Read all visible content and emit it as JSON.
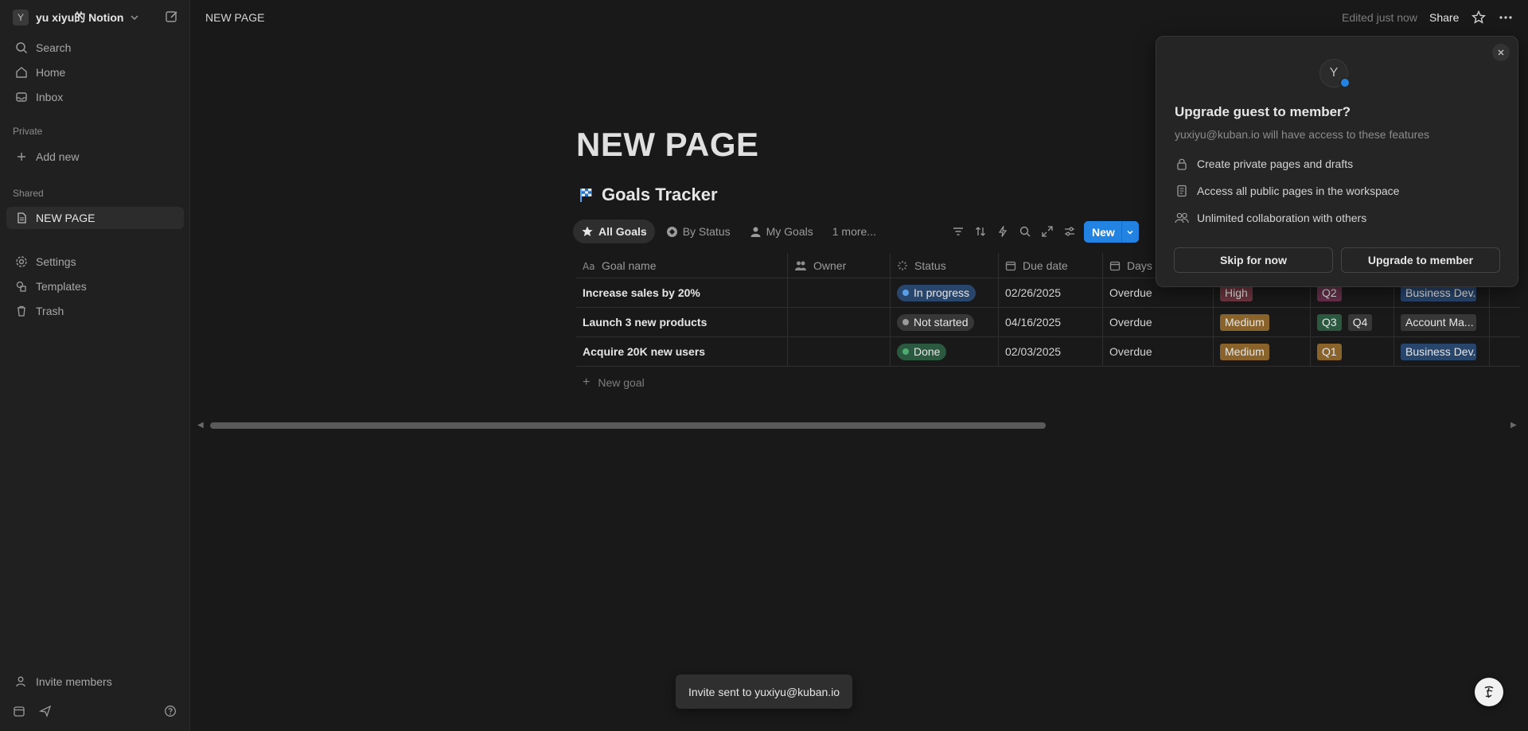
{
  "sidebar": {
    "workspace": {
      "avatar": "Y",
      "name": "yu xiyu的 Notion"
    },
    "nav": [
      {
        "label": "Search",
        "icon": "search-icon"
      },
      {
        "label": "Home",
        "icon": "home-icon"
      },
      {
        "label": "Inbox",
        "icon": "inbox-icon"
      }
    ],
    "private_section": "Private",
    "add_new": "Add new",
    "shared_section": "Shared",
    "shared_pages": [
      {
        "label": "NEW PAGE",
        "icon": "page-icon"
      }
    ],
    "bottom_nav": [
      {
        "label": "Settings",
        "icon": "settings-icon"
      },
      {
        "label": "Templates",
        "icon": "templates-icon"
      },
      {
        "label": "Trash",
        "icon": "trash-icon"
      }
    ],
    "invite": "Invite members"
  },
  "topbar": {
    "breadcrumb": "NEW PAGE",
    "edited": "Edited just now",
    "share": "Share"
  },
  "page": {
    "title": "NEW PAGE",
    "database": {
      "title": "Goals Tracker",
      "views": [
        {
          "label": "All Goals",
          "icon": "star-icon"
        },
        {
          "label": "By Status",
          "icon": "status-icon"
        },
        {
          "label": "My Goals",
          "icon": "person-icon"
        },
        {
          "label": "1 more..."
        }
      ],
      "new_button": "New",
      "columns": [
        "Goal name",
        "Owner",
        "Status",
        "Due date",
        "Days"
      ],
      "rows": [
        {
          "name": "Increase sales by 20%",
          "owner": "",
          "status": "In progress",
          "due": "02/26/2025",
          "days": "Overdue",
          "priority": "High",
          "quarters": [
            "Q2"
          ],
          "team": "Business Dev..."
        },
        {
          "name": "Launch 3 new products",
          "owner": "",
          "status": "Not started",
          "due": "04/16/2025",
          "days": "Overdue",
          "priority": "Medium",
          "quarters": [
            "Q3",
            "Q4"
          ],
          "team": "Account Ma..."
        },
        {
          "name": "Acquire 20K new users",
          "owner": "",
          "status": "Done",
          "due": "02/03/2025",
          "days": "Overdue",
          "priority": "Medium",
          "quarters": [
            "Q1"
          ],
          "team": "Business Dev..."
        }
      ],
      "new_row": "New goal"
    }
  },
  "popover": {
    "avatar": "Y",
    "title": "Upgrade guest to member?",
    "subtitle": "yuxiyu@kuban.io will have access to these features",
    "features": [
      {
        "label": "Create private pages and drafts",
        "icon": "lock-icon"
      },
      {
        "label": "Access all public pages in the workspace",
        "icon": "document-icon"
      },
      {
        "label": "Unlimited collaboration with others",
        "icon": "people-icon"
      }
    ],
    "skip": "Skip for now",
    "upgrade": "Upgrade to member"
  },
  "toast": "Invite sent to yuxiyu@kuban.io",
  "colors": {
    "accent": "#2383e2",
    "in_progress": "#28456c",
    "not_started": "#373737",
    "done": "#2b593f",
    "high": "#6e363f",
    "medium": "#89632a",
    "q2": "#69314c",
    "q3": "#2b593f",
    "q4": "#373737",
    "q1": "#89632a",
    "team_bd": "#28456c",
    "team_am": "#373737"
  }
}
